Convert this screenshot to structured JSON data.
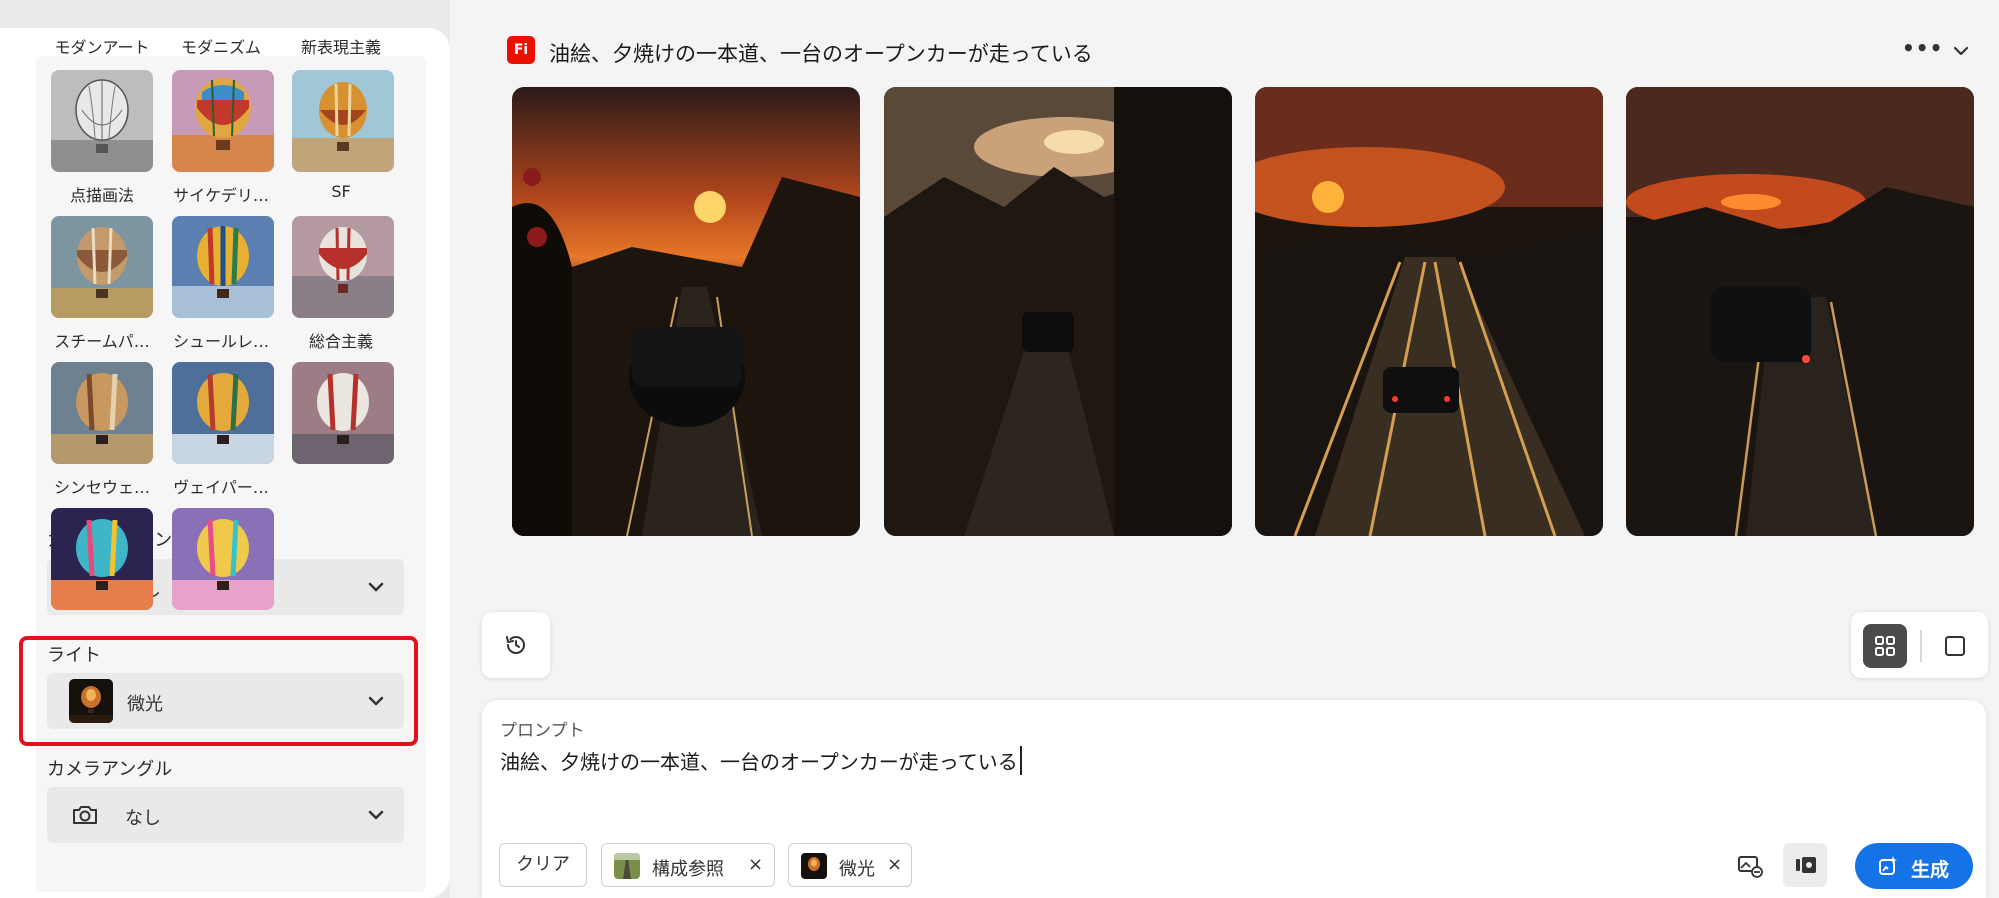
{
  "sidebar": {
    "styles": [
      {
        "label": "モダンアート",
        "icon": "balloon-sketch-thumbnail"
      },
      {
        "label": "モダニズム",
        "icon": "balloon-modernism-thumbnail"
      },
      {
        "label": "新表現主義",
        "icon": "balloon-neo-expressionism-thumbnail"
      },
      {
        "label": "点描画法",
        "icon": "balloon-pointillism-thumbnail"
      },
      {
        "label": "サイケデリ…",
        "icon": "balloon-psychedelic-thumbnail"
      },
      {
        "label": "SF",
        "icon": "balloon-scifi-thumbnail"
      },
      {
        "label": "スチームパ…",
        "icon": "balloon-steampunk-thumbnail"
      },
      {
        "label": "シュールレ…",
        "icon": "balloon-surreal-thumbnail"
      },
      {
        "label": "総合主義",
        "icon": "balloon-synthetism-thumbnail"
      },
      {
        "label": "シンセウェ…",
        "icon": "balloon-synthwave-thumbnail"
      },
      {
        "label": "ヴェイパー…",
        "icon": "balloon-vaporwave-thumbnail"
      }
    ],
    "color_tone": {
      "label": "カラーとトーン",
      "value": "なし",
      "icon": "palette-icon"
    },
    "lighting": {
      "label": "ライト",
      "value": "微光",
      "icon": "dim-light-thumbnail"
    },
    "camera_angle": {
      "label": "カメラアングル",
      "value": "なし",
      "icon": "camera-icon"
    }
  },
  "header": {
    "app_badge": "Fi",
    "title": "油絵、夕焼けの一本道、一台のオープンカーが走っている",
    "more_icon": "more-icon",
    "collapse_icon": "chevron-down-icon"
  },
  "results": [
    {
      "icon": "generated-image"
    },
    {
      "icon": "generated-image"
    },
    {
      "icon": "generated-image"
    },
    {
      "icon": "generated-image"
    }
  ],
  "view_toggle": {
    "selected": "grid"
  },
  "prompt": {
    "label": "プロンプト",
    "value": "油絵、夕焼けの一本道、一台のオープンカーが走っている",
    "clear_label": "クリア",
    "tags": [
      {
        "label": "構成参照",
        "close": "×"
      },
      {
        "label": "微光",
        "close": "×"
      }
    ],
    "generate_label": "生成"
  },
  "colors": {
    "accent": "#1473e6",
    "badge": "#eb1000",
    "highlight": "#e3101e"
  }
}
